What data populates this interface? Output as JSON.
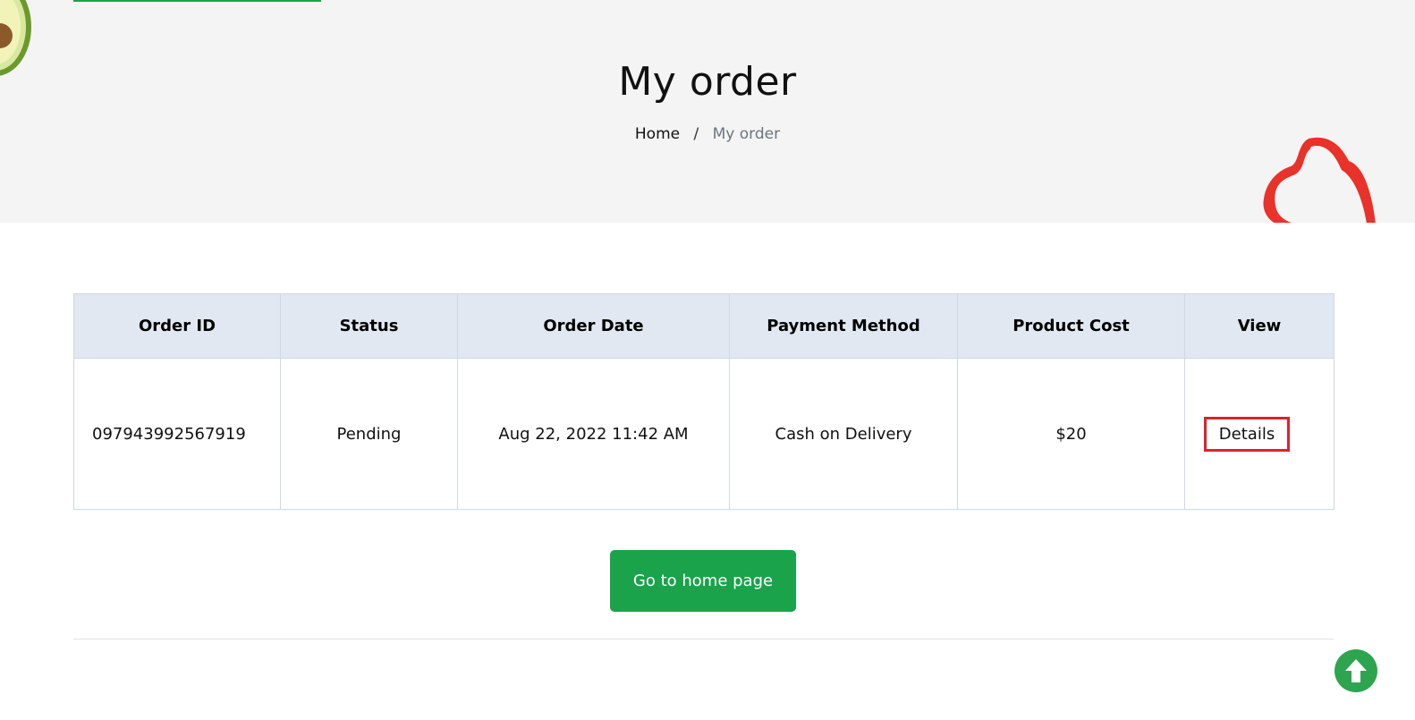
{
  "header": {
    "title": "My order",
    "breadcrumb": {
      "home": "Home",
      "separator": "/",
      "current": "My order"
    }
  },
  "table": {
    "columns": [
      "Order ID",
      "Status",
      "Order Date",
      "Payment Method",
      "Product Cost",
      "View"
    ],
    "rows": [
      {
        "order_id": "097943992567919",
        "status": "Pending",
        "order_date": "Aug 22, 2022 11:42 AM",
        "payment_method": "Cash on Delivery",
        "product_cost": "$20",
        "view_label": "Details"
      }
    ]
  },
  "actions": {
    "home_button": "Go to home page"
  },
  "icons": {
    "scroll_top": "arrow-up-circle-icon",
    "decor_left": "avocado-image",
    "decor_right": "red-pepper-ring-image"
  },
  "colors": {
    "accent": "#1aa34a",
    "header_bg": "#e1e8f1",
    "highlight": "#e0202f"
  }
}
